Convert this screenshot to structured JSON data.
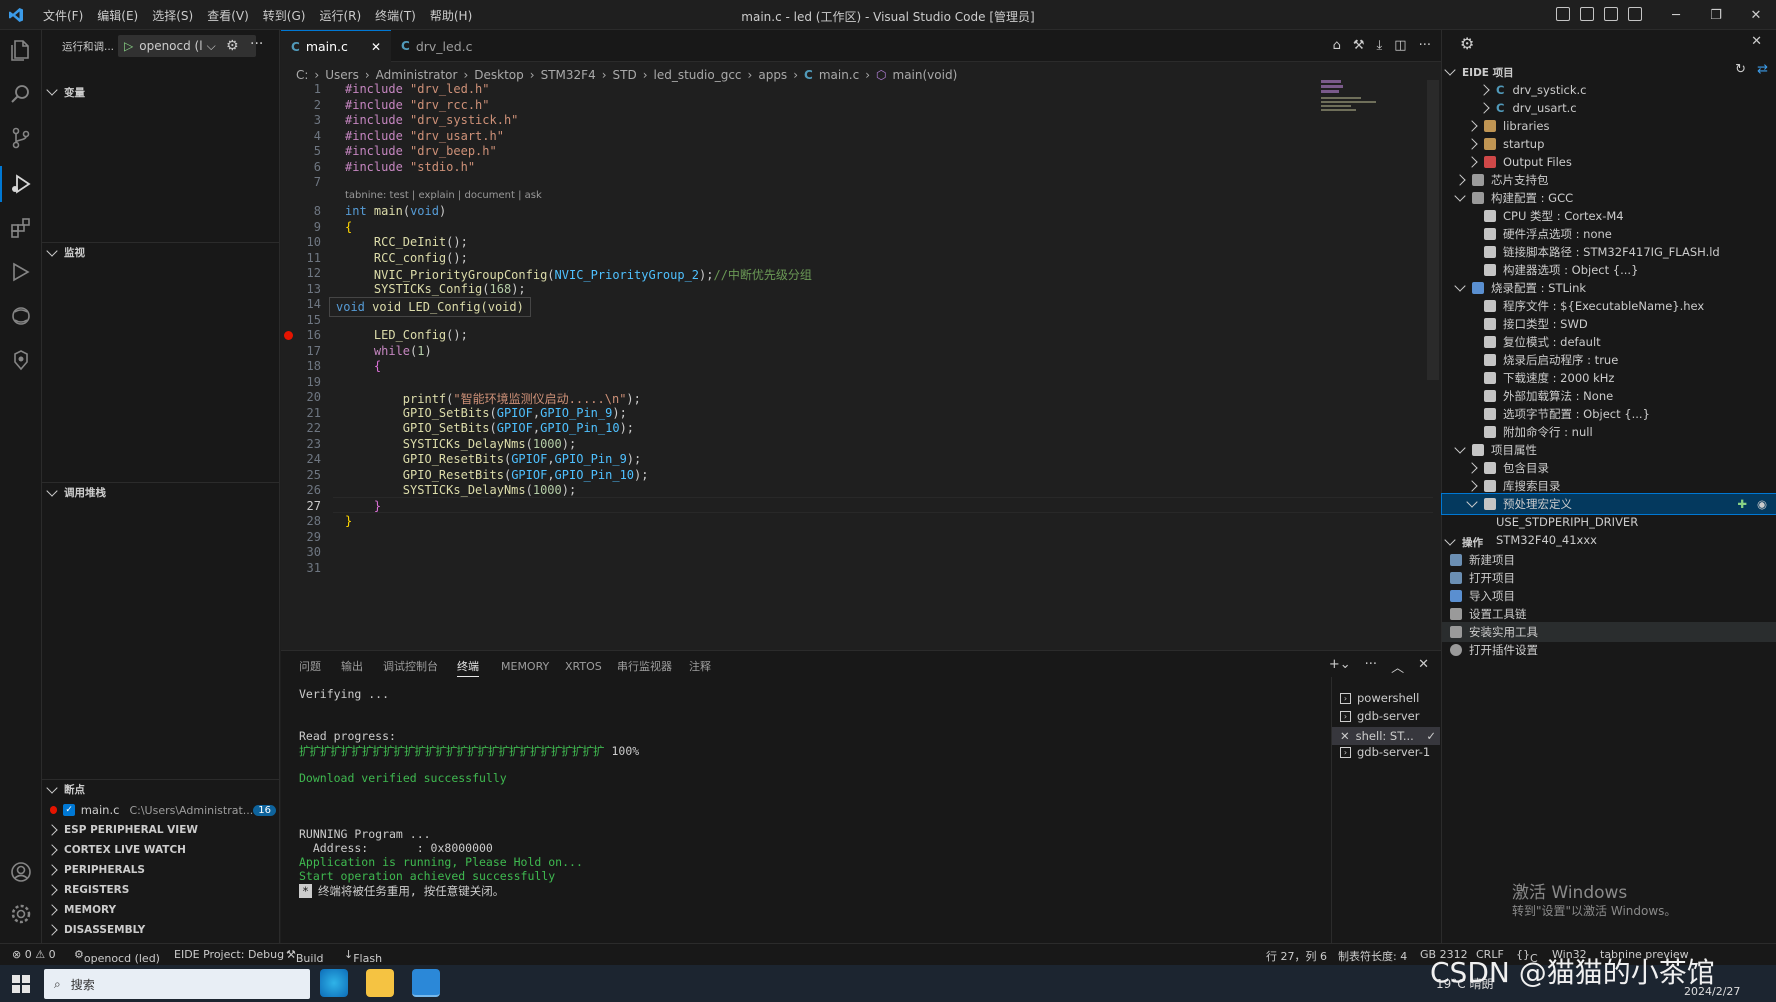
{
  "titlebar": {
    "title": "main.c - led (工作区) - Visual Studio Code [管理员]",
    "menu": [
      "文件(F)",
      "编辑(E)",
      "选择(S)",
      "查看(V)",
      "转到(G)",
      "运行(R)",
      "终端(T)",
      "帮助(H)"
    ]
  },
  "sidebar": {
    "run_label": "运行和调...",
    "config_name": "openocd (l",
    "sections": {
      "variables": "变量",
      "watch": "监视",
      "callstack": "调用堆栈",
      "breakpoints": "断点"
    },
    "breakpoint": {
      "file": "main.c",
      "path": "C:\\Users\\Administrat...",
      "line": "16"
    },
    "collapsed": [
      "ESP PERIPHERAL VIEW",
      "CORTEX LIVE WATCH",
      "PERIPHERALS",
      "REGISTERS",
      "MEMORY",
      "DISASSEMBLY"
    ]
  },
  "editor": {
    "tabs": [
      {
        "label": "main.c",
        "active": true
      },
      {
        "label": "drv_led.c",
        "active": false
      }
    ],
    "breadcrumb": [
      "C:",
      "Users",
      "Administrator",
      "Desktop",
      "STM32F4",
      "STD",
      "led_studio_gcc",
      "apps",
      "main.c",
      "main(void)"
    ],
    "codelens": "tabnine: test | explain | document | ask",
    "hover": "void LED_Config(void)",
    "current_line": "27"
  },
  "panel": {
    "tabs": [
      "问题",
      "输出",
      "调试控制台",
      "终端",
      "MEMORY",
      "XRTOS",
      "串行监视器",
      "注释"
    ],
    "active_tab": "终端",
    "terminal": {
      "verifying": "Verifying ...",
      "read_progress": "Read progress:",
      "progress_bar": "[ŀŀŀŀŀŀŀŀŀŀŀŀŀŀŀŀŀŀŀŀŀŀŀŀŀŀŀŀŀŀŀŀŀŀŀŀŀŀŀŀŀŀŀŀŀŀŀŀŀŀ] 100%",
      "progress_percent": "100%",
      "download_ok": "Download verified successfully",
      "running": "RUNNING Program ...",
      "address": "  Address:       : 0x8000000",
      "app_running": "Application is running, Please Hold on...",
      "start_ok": "Start operation achieved successfully",
      "reuse": "终端将被任务重用, 按任意键关闭。"
    },
    "terminals": [
      "powershell",
      "gdb-server",
      "shell: ST...",
      "gdb-server-1"
    ]
  },
  "eide": {
    "header": "EIDE 项目",
    "tree": [
      {
        "label": "drv_systick.c",
        "indent": 2,
        "chev": "right",
        "icon": "c"
      },
      {
        "label": "drv_usart.c",
        "indent": 2,
        "chev": "right",
        "icon": "c"
      },
      {
        "label": "libraries",
        "indent": 1,
        "chev": "right",
        "icon": "folder"
      },
      {
        "label": "startup",
        "indent": 1,
        "chev": "right",
        "icon": "folder"
      },
      {
        "label": "Output Files",
        "indent": 1,
        "chev": "right",
        "icon": "folder-red"
      },
      {
        "label": "芯片支持包",
        "indent": 0,
        "chev": "right",
        "icon": "chip"
      },
      {
        "label": "构建配置 : GCC",
        "indent": 0,
        "chev": "down",
        "icon": "build"
      },
      {
        "label": "CPU 类型 : Cortex-M4",
        "indent": 1,
        "chev": "",
        "icon": "gear"
      },
      {
        "label": "硬件浮点选项 : none",
        "indent": 1,
        "chev": "",
        "icon": "wrench"
      },
      {
        "label": "链接脚本路径 : STM32F417IG_FLASH.ld",
        "indent": 1,
        "chev": "",
        "icon": "wrench"
      },
      {
        "label": "构建器选项 : Object {...}",
        "indent": 1,
        "chev": "",
        "icon": "doc"
      },
      {
        "label": "烧录配置 : STLink",
        "indent": 0,
        "chev": "down",
        "icon": "flash"
      },
      {
        "label": "程序文件 : ${ExecutableName}.hex",
        "indent": 1,
        "chev": "",
        "icon": "doc"
      },
      {
        "label": "接口类型 : SWD",
        "indent": 1,
        "chev": "",
        "icon": "wrench"
      },
      {
        "label": "复位模式 : default",
        "indent": 1,
        "chev": "",
        "icon": "wrench"
      },
      {
        "label": "烧录后启动程序 : true",
        "indent": 1,
        "chev": "",
        "icon": "wrench"
      },
      {
        "label": "下载速度 : 2000 kHz",
        "indent": 1,
        "chev": "",
        "icon": "wrench"
      },
      {
        "label": "外部加载算法 : None",
        "indent": 1,
        "chev": "",
        "icon": "wrench"
      },
      {
        "label": "选项字节配置 : Object {...}",
        "indent": 1,
        "chev": "",
        "icon": "doc"
      },
      {
        "label": "附加命令行 : null",
        "indent": 1,
        "chev": "",
        "icon": "terminal"
      },
      {
        "label": "项目属性",
        "indent": 0,
        "chev": "down",
        "icon": "wrench"
      },
      {
        "label": "包含目录",
        "indent": 1,
        "chev": "right",
        "icon": "list"
      },
      {
        "label": "库搜索目录",
        "indent": 1,
        "chev": "right",
        "icon": "list"
      },
      {
        "label": "预处理宏定义",
        "indent": 1,
        "chev": "down",
        "icon": "list",
        "selected": true
      },
      {
        "label": "USE_STDPERIPH_DRIVER",
        "indent": 2,
        "chev": "",
        "icon": ""
      },
      {
        "label": "STM32F40_41xxx",
        "indent": 2,
        "chev": "",
        "icon": ""
      }
    ],
    "ops_header": "操作",
    "ops": [
      "新建项目",
      "打开项目",
      "导入项目",
      "设置工具链",
      "安装实用工具",
      "打开插件设置"
    ]
  },
  "watermark": {
    "line1": "激活 Windows",
    "line2": "转到\"设置\"以激活 Windows。",
    "csdn": "CSDN @猫猫的小茶馆"
  },
  "statusbar": {
    "errors": "⊗ 0 ⚠ 0",
    "debug": "openocd (led)",
    "eide": "EIDE Project: Debug",
    "build": "Build",
    "flash": "Flash",
    "position": "行 27，列 6",
    "tabsize": "制表符长度: 4",
    "encoding": "GB 2312",
    "eol": "CRLF",
    "lang": "C",
    "platform": "Win32",
    "tabnine": "tabnine preview"
  },
  "taskbar": {
    "search": "搜索",
    "weather": "19°C 晴朗",
    "date": "2024/2/27"
  },
  "colors": {
    "accent": "#0078d4",
    "bg": "#1e1e1e",
    "breakpoint": "#e51400"
  }
}
